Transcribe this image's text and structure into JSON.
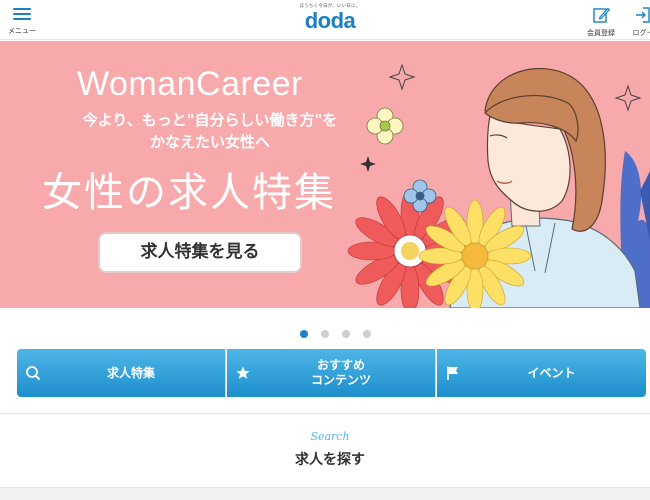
{
  "header": {
    "menu_label": "メニュー",
    "logo_tagline": "ほうちく今日が、いい日に。",
    "logo_word": "doda",
    "register_label": "会員登録",
    "login_label": "ログイ"
  },
  "banner": {
    "brand": "WomanCareer",
    "tagline_line1": "今より、もっと\"自分らしい働き方\"を",
    "tagline_line2": "かなえたい女性へ",
    "headline": "女性の求人特集",
    "cta_label": "求人特集を見る"
  },
  "carousel": {
    "slide_count": 4,
    "active_index": 0
  },
  "nav": [
    {
      "label": "求人特集",
      "icon": "search-icon"
    },
    {
      "label": "おすすめ\nコンテンツ",
      "line1": "おすすめ",
      "line2": "コンテンツ",
      "icon": "star-icon"
    },
    {
      "label": "イベント",
      "icon": "flag-icon"
    }
  ],
  "search": {
    "script_label": "Search",
    "title": "求人を探す"
  },
  "colors": {
    "brand_blue": "#1b7fc4",
    "banner_pink": "#f8a9ab",
    "nav_top": "#4fb5e7",
    "nav_bottom": "#1d8fcc"
  }
}
